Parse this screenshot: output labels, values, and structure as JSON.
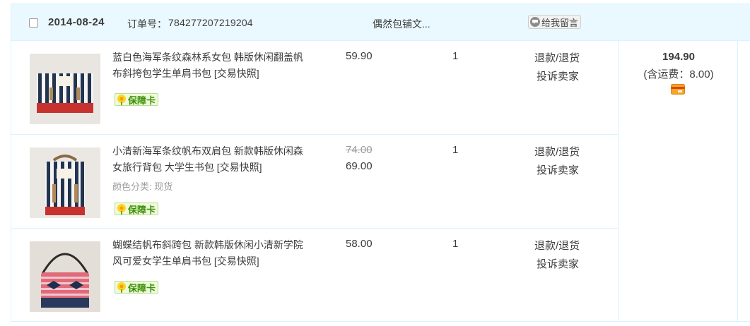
{
  "header": {
    "date": "2014-08-24",
    "order_no_label": "订单号：",
    "order_no": "784277207219204",
    "shop_name": "偶然包铺文...",
    "message_button": "给我留言"
  },
  "items": [
    {
      "title": "蓝白色海军条纹森林系女包 韩版休闲翻盖帆布斜挎包学生单肩书包 [交易快照]",
      "price": "59.90",
      "quantity": "1",
      "refund_label": "退款/退货",
      "complain_label": "投诉卖家",
      "badge_label": "保障卡"
    },
    {
      "title": "小清新海军条纹帆布双肩包 新款韩版休闲森女旅行背包 大学生书包 [交易快照]",
      "original_price": "74.00",
      "price": "69.00",
      "quantity": "1",
      "sku": "颜色分类: 现货",
      "refund_label": "退款/退货",
      "complain_label": "投诉卖家",
      "badge_label": "保障卡"
    },
    {
      "title": "蝴蝶结帆布斜跨包 新款韩版休闲小清新学院风可爱女学生单肩书包 [交易快照]",
      "price": "58.00",
      "quantity": "1",
      "refund_label": "退款/退货",
      "complain_label": "投诉卖家",
      "badge_label": "保障卡"
    }
  ],
  "total": {
    "amount": "194.90",
    "shipping": "(含运费：8.00)"
  },
  "colors": {
    "header_bg": "#eaf8ff",
    "border": "#daf3ff",
    "badge_green": "#3d8f08",
    "card_icon": "#f5a623"
  },
  "icons": {
    "checkbox": "checkbox-icon",
    "message": "chat-bubble-icon",
    "badge": "flower-shield-icon",
    "payment": "card-icon"
  }
}
